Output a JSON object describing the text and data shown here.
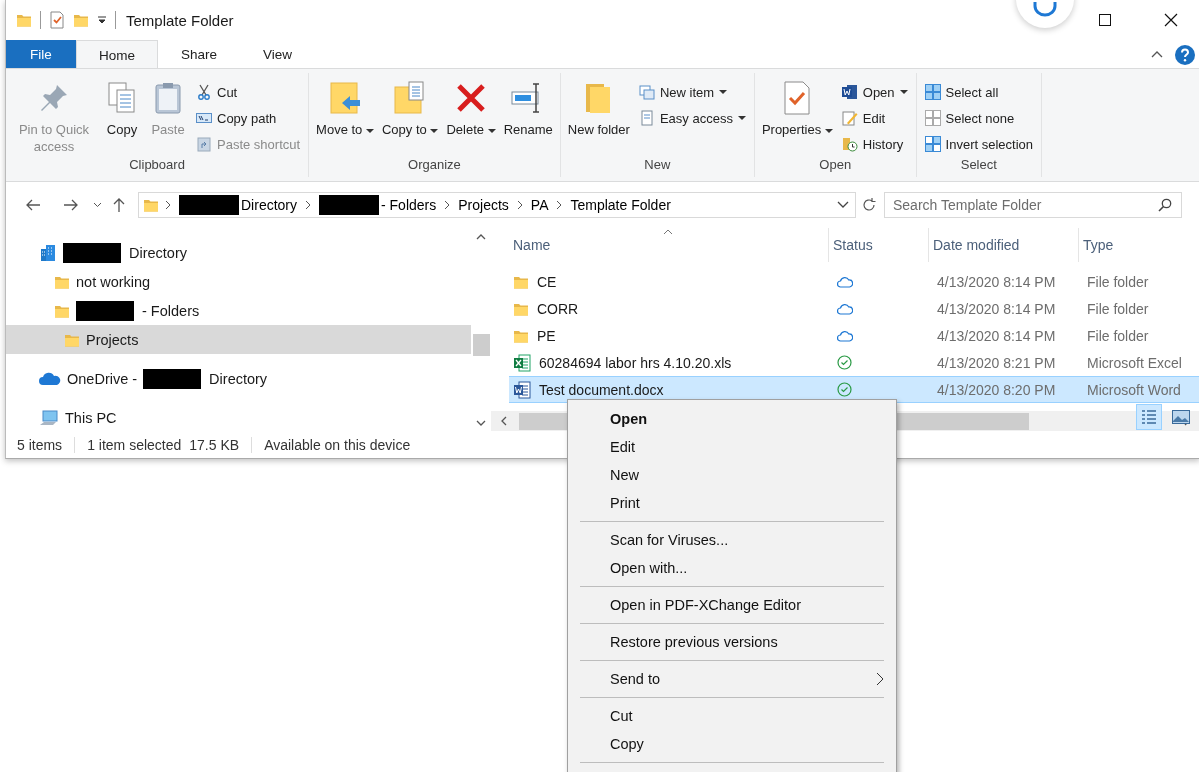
{
  "window": {
    "title": "Template Folder"
  },
  "ribbon_tabs": [
    {
      "label": "File",
      "kind": "file",
      "selected": false
    },
    {
      "label": "Home",
      "kind": "tab",
      "selected": true
    },
    {
      "label": "Share",
      "kind": "tab",
      "selected": false
    },
    {
      "label": "View",
      "kind": "tab",
      "selected": false
    }
  ],
  "ribbon_groups": [
    {
      "label": "Clipboard",
      "items": [
        {
          "label": "Pin to Quick access",
          "kind": "large",
          "disabled": true,
          "dropdown": false
        },
        {
          "label": "Copy",
          "kind": "large",
          "disabled": false,
          "dropdown": false
        },
        {
          "label": "Paste",
          "kind": "large",
          "disabled": true,
          "dropdown": false
        },
        {
          "label": "Cut",
          "kind": "small",
          "disabled": false,
          "dropdown": false
        },
        {
          "label": "Copy path",
          "kind": "small",
          "disabled": false,
          "dropdown": false
        },
        {
          "label": "Paste shortcut",
          "kind": "small",
          "disabled": true,
          "dropdown": false
        }
      ]
    },
    {
      "label": "Organize",
      "items": [
        {
          "label": "Move to",
          "kind": "large",
          "disabled": false,
          "dropdown": true
        },
        {
          "label": "Copy to",
          "kind": "large",
          "disabled": false,
          "dropdown": true
        },
        {
          "label": "Delete",
          "kind": "large",
          "disabled": false,
          "dropdown": true
        },
        {
          "label": "Rename",
          "kind": "large",
          "disabled": false,
          "dropdown": false
        }
      ]
    },
    {
      "label": "New",
      "items": [
        {
          "label": "New folder",
          "kind": "large",
          "disabled": false,
          "dropdown": false
        },
        {
          "label": "New item",
          "kind": "small",
          "disabled": false,
          "dropdown": true
        },
        {
          "label": "Easy access",
          "kind": "small",
          "disabled": false,
          "dropdown": true
        }
      ]
    },
    {
      "label": "Open",
      "items": [
        {
          "label": "Properties",
          "kind": "large",
          "disabled": false,
          "dropdown": true
        },
        {
          "label": "Open",
          "kind": "small",
          "disabled": false,
          "dropdown": true
        },
        {
          "label": "Edit",
          "kind": "small",
          "disabled": false,
          "dropdown": false
        },
        {
          "label": "History",
          "kind": "small",
          "disabled": false,
          "dropdown": false
        }
      ]
    },
    {
      "label": "Select",
      "items": [
        {
          "label": "Select all",
          "kind": "small",
          "disabled": false,
          "dropdown": false
        },
        {
          "label": "Select none",
          "kind": "small",
          "disabled": false,
          "dropdown": false
        },
        {
          "label": "Invert selection",
          "kind": "small",
          "disabled": false,
          "dropdown": false
        }
      ]
    }
  ],
  "breadcrumbs": [
    {
      "segments": [
        {
          "kind": "redacted"
        },
        {
          "kind": "text",
          "text": "Directory"
        }
      ]
    },
    {
      "segments": [
        {
          "kind": "redacted"
        },
        {
          "kind": "text",
          "text": "- Folders"
        }
      ]
    },
    {
      "segments": [
        {
          "kind": "text",
          "text": "Projects"
        }
      ]
    },
    {
      "segments": [
        {
          "kind": "text",
          "text": "PA"
        }
      ]
    },
    {
      "segments": [
        {
          "kind": "text",
          "text": "Template Folder"
        }
      ]
    }
  ],
  "search": {
    "placeholder": "Search Template Folder"
  },
  "nav_tree": [
    {
      "kind": "network",
      "selected": false,
      "segments": [
        {
          "kind": "redacted"
        },
        {
          "kind": "text",
          "text": "Directory"
        }
      ],
      "children": [
        {
          "kind": "folder",
          "selected": false,
          "segments": [
            {
              "kind": "text",
              "text": "not working"
            }
          ]
        },
        {
          "kind": "folder",
          "selected": false,
          "segments": [
            {
              "kind": "redacted"
            },
            {
              "kind": "text",
              "text": "- Folders"
            }
          ],
          "children": [
            {
              "kind": "folder",
              "selected": true,
              "segments": [
                {
                  "kind": "text",
                  "text": "Projects"
                }
              ]
            }
          ]
        }
      ]
    },
    {
      "kind": "cloud",
      "selected": false,
      "segments": [
        {
          "kind": "text",
          "text": "OneDrive -"
        },
        {
          "kind": "redacted"
        },
        {
          "kind": "text",
          "text": "Directory"
        }
      ]
    },
    {
      "kind": "computer",
      "selected": false,
      "segments": [
        {
          "kind": "text",
          "text": "This PC"
        }
      ]
    }
  ],
  "columns": [
    "Name",
    "Status",
    "Date modified",
    "Type"
  ],
  "files": [
    {
      "kind": "folder",
      "name": "CE",
      "available_offline": false,
      "date": "4/13/2020 8:14 PM",
      "type": "File folder",
      "selected": false
    },
    {
      "kind": "folder",
      "name": "CORR",
      "available_offline": false,
      "date": "4/13/2020 8:14 PM",
      "type": "File folder",
      "selected": false
    },
    {
      "kind": "folder",
      "name": "PE",
      "available_offline": false,
      "date": "4/13/2020 8:14 PM",
      "type": "File folder",
      "selected": false
    },
    {
      "kind": "excel",
      "name": "60284694 labor hrs 4.10.20.xls",
      "available_offline": true,
      "date": "4/13/2020 8:21 PM",
      "type": "Microsoft Excel",
      "selected": false
    },
    {
      "kind": "word",
      "name": "Test document.docx",
      "available_offline": true,
      "date": "4/13/2020 8:20 PM",
      "type": "Microsoft Word",
      "selected": true
    }
  ],
  "status_bar": {
    "item_count": "5 items",
    "selection": "1 item selected",
    "size": "17.5 KB",
    "availability": "Available on this device"
  },
  "context_menu": {
    "sections": [
      {
        "items": [
          {
            "label": "Open",
            "default": true,
            "submenu": false
          },
          {
            "label": "Edit",
            "default": false,
            "submenu": false
          },
          {
            "label": "New",
            "default": false,
            "submenu": false
          },
          {
            "label": "Print",
            "default": false,
            "submenu": false
          }
        ]
      },
      {
        "items": [
          {
            "label": "Scan for Viruses...",
            "default": false,
            "submenu": false
          },
          {
            "label": "Open with...",
            "default": false,
            "submenu": false
          }
        ]
      },
      {
        "items": [
          {
            "label": "Open in PDF-XChange Editor",
            "default": false,
            "submenu": false
          }
        ]
      },
      {
        "items": [
          {
            "label": "Restore previous versions",
            "default": false,
            "submenu": false
          }
        ]
      },
      {
        "items": [
          {
            "label": "Send to",
            "default": false,
            "submenu": true
          }
        ]
      },
      {
        "items": [
          {
            "label": "Cut",
            "default": false,
            "submenu": false
          },
          {
            "label": "Copy",
            "default": false,
            "submenu": false
          }
        ]
      }
    ]
  }
}
